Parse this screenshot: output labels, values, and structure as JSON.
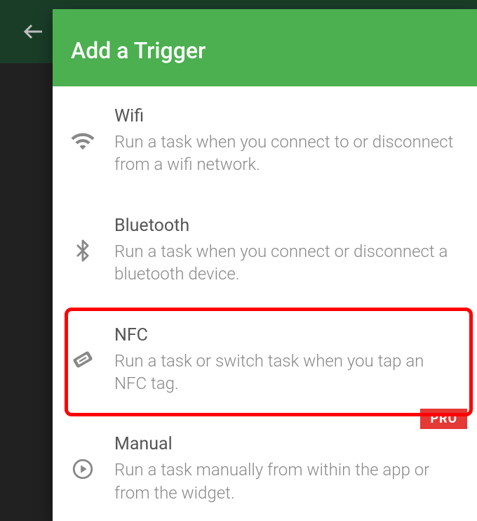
{
  "dialog": {
    "title": "Add a Trigger"
  },
  "triggers": [
    {
      "title": "Wifi",
      "desc": "Run a task when you connect to or disconnect from a wifi network."
    },
    {
      "title": "Bluetooth",
      "desc": "Run a task when you connect or disconnect a bluetooth device."
    },
    {
      "title": "NFC",
      "desc": "Run a task or switch task when you tap an NFC tag."
    },
    {
      "title": "Manual",
      "desc": "Run a task manually from within the app or from the widget."
    }
  ],
  "badges": {
    "pro": "PRO"
  }
}
